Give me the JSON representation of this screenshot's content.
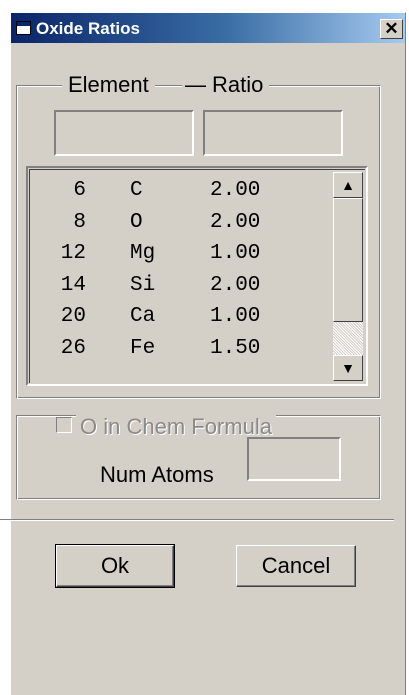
{
  "window": {
    "title": "Oxide Ratios",
    "close_symbol": "✕"
  },
  "group_main": {
    "legend_element": "Element",
    "legend_separator": "—",
    "legend_ratio": "Ratio"
  },
  "inputs": {
    "element_value": "",
    "ratio_value": "",
    "num_atoms_value": ""
  },
  "list": {
    "rows": [
      {
        "number": "6",
        "symbol": "C",
        "ratio": "2.00"
      },
      {
        "number": "8",
        "symbol": "O",
        "ratio": "2.00"
      },
      {
        "number": "12",
        "symbol": "Mg",
        "ratio": "1.00"
      },
      {
        "number": "14",
        "symbol": "Si",
        "ratio": "2.00"
      },
      {
        "number": "20",
        "symbol": "Ca",
        "ratio": "1.00"
      },
      {
        "number": "26",
        "symbol": "Fe",
        "ratio": "1.50"
      }
    ],
    "scroll_up_icon": "▲",
    "scroll_down_icon": "▼"
  },
  "group_formula": {
    "checkbox_label": "O in Chem Formula",
    "checkbox_checked": false,
    "checkbox_enabled": false,
    "num_atoms_label": "Num Atoms"
  },
  "buttons": {
    "ok": "Ok",
    "cancel": "Cancel"
  }
}
